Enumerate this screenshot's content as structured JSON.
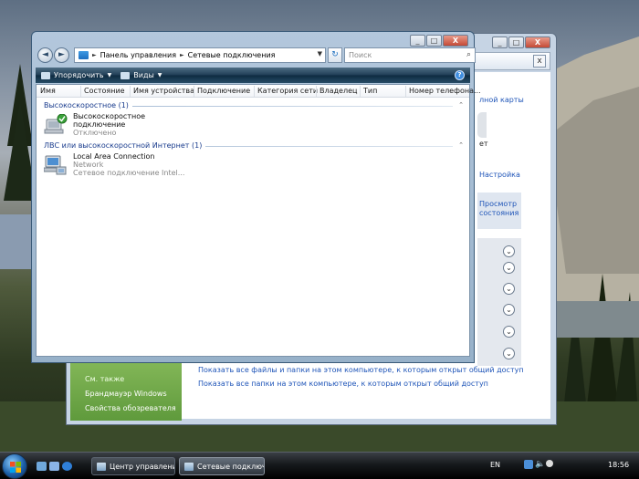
{
  "background_window": {
    "caption_buttons": [
      "_",
      "□",
      "X"
    ],
    "toolbar_close": "x",
    "right_text": {
      "map_link": "лной карты",
      "partial": "ет",
      "settings": "Настройка",
      "view_status_1": "Просмотр",
      "view_status_2": "состояния"
    },
    "chevron": "⌄",
    "see_also": {
      "heading": "См. также",
      "items": [
        "Брандмауэр Windows",
        "Свойства обозревателя"
      ]
    },
    "links": [
      "Показать все файлы и папки на этом компьютере, к которым открыт общий доступ",
      "Показать все папки на этом компьютере, к которым открыт общий доступ"
    ]
  },
  "explorer": {
    "caption_buttons": [
      "_",
      "□",
      "X"
    ],
    "nav": {
      "back": "◄",
      "forward": "►"
    },
    "address": {
      "segments": [
        "Панель управления",
        "Сетевые подключения"
      ],
      "separator": "►",
      "dropdown": "▼"
    },
    "refresh_glyph": "↻",
    "search": {
      "placeholder": "Поиск",
      "icon": "search-icon"
    },
    "command_bar": {
      "organize": "Упорядочить",
      "views": "Виды",
      "arrow": "▼",
      "help": "?"
    },
    "columns": [
      "Имя",
      "Состояние",
      "Имя устройства",
      "Подключение",
      "Категория сети",
      "Владелец",
      "Тип",
      "Номер телефона..."
    ],
    "groups": [
      {
        "title": "Высокоскоростное (1)",
        "collapse_glyph": "⌃",
        "items": [
          {
            "name_line1": "Высокоскоростное",
            "name_line2": "подключение",
            "status": "Отключено",
            "icon": "broadband-connection-icon"
          }
        ]
      },
      {
        "title": "ЛВС или высокоскоростной Интернет (1)",
        "collapse_glyph": "⌃",
        "items": [
          {
            "name": "Local Area Connection",
            "category": "Network",
            "device": "Сетевое подключение Intel...",
            "icon": "lan-connection-icon"
          }
        ]
      }
    ]
  },
  "taskbar": {
    "buttons": [
      {
        "label": "Центр управления ...",
        "active": false
      },
      {
        "label": "Сетевые подключе...",
        "active": true
      }
    ],
    "language": "EN",
    "clock": "18:56"
  },
  "colors": {
    "accent_blue": "#1f55b8",
    "group_title": "#173a8c",
    "see_also_green": "#6aa644"
  }
}
